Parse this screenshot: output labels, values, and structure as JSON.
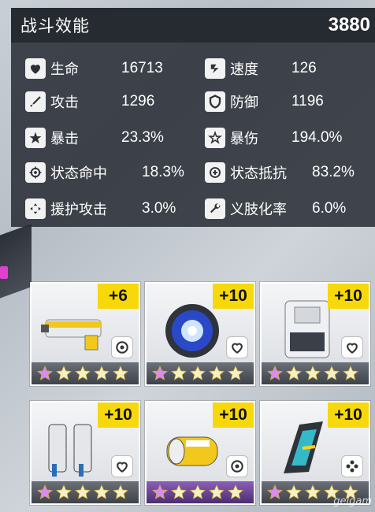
{
  "stats_panel": {
    "title": "战斗效能",
    "power": "3880",
    "stats": [
      {
        "icon": "heart-icon",
        "label": "生命",
        "value": "16713"
      },
      {
        "icon": "speed-icon",
        "label": "速度",
        "value": "126"
      },
      {
        "icon": "sword-icon",
        "label": "攻击",
        "value": "1296"
      },
      {
        "icon": "shield-icon",
        "label": "防御",
        "value": "1196"
      },
      {
        "icon": "crit-star-icon",
        "label": "暴击",
        "value": "23.3%"
      },
      {
        "icon": "crit-damage-icon",
        "label": "暴伤",
        "value": "194.0%"
      },
      {
        "icon": "crosshair-icon",
        "label": "状态命中",
        "value": "18.3%"
      },
      {
        "icon": "resist-icon",
        "label": "状态抵抗",
        "value": "83.2%"
      },
      {
        "icon": "support-arrows-icon",
        "label": "援护攻击",
        "value": "3.0%"
      },
      {
        "icon": "wrench-icon",
        "label": "义肢化率",
        "value": "6.0%"
      }
    ]
  },
  "equipment": [
    {
      "level": "+6",
      "stars": 5,
      "set_icon": "gear-set-icon",
      "color": "#f2c81c"
    },
    {
      "level": "+10",
      "stars": 5,
      "set_icon": "heart-outline-icon",
      "color": "#2a49c8"
    },
    {
      "level": "+10",
      "stars": 5,
      "set_icon": "heart-outline-icon",
      "color": "#3a3f48"
    },
    {
      "level": "+10",
      "stars": 5,
      "set_icon": "heart-outline-icon",
      "color": "#e4e6ea"
    },
    {
      "level": "+10",
      "stars": 5,
      "set_icon": "gear-set-icon",
      "color": "#f2c81c"
    },
    {
      "level": "+10",
      "stars": 5,
      "set_icon": "flower-set-icon",
      "color": "#34b9c9"
    }
  ],
  "watermark": "gelgam"
}
